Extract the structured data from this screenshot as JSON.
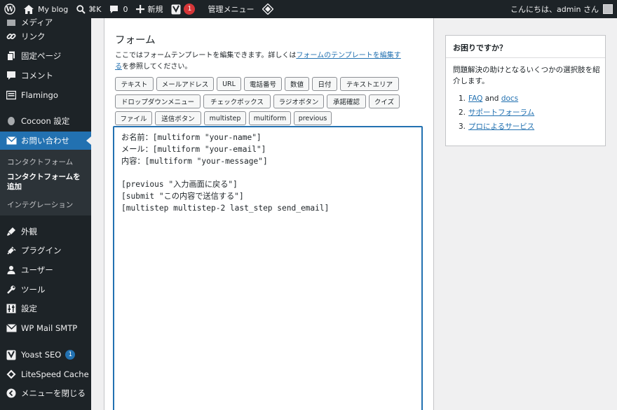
{
  "adminbar": {
    "site_name": "My blog",
    "search_shortcut": "⌘K",
    "comments_count": "0",
    "new_label": "新規",
    "yoast_count": "1",
    "manage_menu": "管理メニュー",
    "greeting": "こんにちは、admin さん"
  },
  "sidebar": {
    "items": [
      {
        "label": "メディア"
      },
      {
        "label": "リンク"
      },
      {
        "label": "固定ページ"
      },
      {
        "label": "コメント"
      },
      {
        "label": "Flamingo"
      },
      {
        "label": "Cocoon 設定"
      },
      {
        "label": "お問い合わせ"
      },
      {
        "label": "外観"
      },
      {
        "label": "プラグイン"
      },
      {
        "label": "ユーザー"
      },
      {
        "label": "ツール"
      },
      {
        "label": "設定"
      },
      {
        "label": "WP Mail SMTP"
      },
      {
        "label": "Yoast SEO",
        "badge": "1"
      },
      {
        "label": "LiteSpeed Cache"
      },
      {
        "label": "メニューを閉じる"
      }
    ],
    "submenu": {
      "contact_forms": "コンタクトフォーム",
      "add_new_line1": "コンタクトフォームを",
      "add_new_line2": "追加",
      "integration": "インテグレーション"
    }
  },
  "form_panel": {
    "title": "フォーム",
    "desc_before": "ここではフォームテンプレートを編集できます。詳しくは",
    "desc_link_line1": "フォームのテンプレートを編集す",
    "desc_link_line2": "る",
    "desc_after": "を参照してください。",
    "tags": [
      "テキスト",
      "メールアドレス",
      "URL",
      "電話番号",
      "数値",
      "日付",
      "テキストエリア",
      "ドロップダウンメニュー",
      "チェックボックス",
      "ラジオボタン",
      "承諾確認",
      "クイズ",
      "ファイル",
      "送信ボタン",
      "multistep",
      "multiform",
      "previous"
    ],
    "template_lines": [
      "お名前：[multiform \"your-name\"]",
      "メール：[multiform \"your-email\"]",
      "内容：[multiform \"your-message\"]",
      "",
      "[previous \"入力画面に戻る\"]",
      "[submit \"この内容で送信する\"]",
      "[multistep multistep-2 last_step send_email]"
    ]
  },
  "help": {
    "title": "お困りですか？",
    "desc": "問題解決の助けとなるいくつかの選択肢を紹介します。",
    "items": [
      {
        "num": "1.",
        "link1": "FAQ",
        "and": " and ",
        "link2": "docs"
      },
      {
        "num": "2.",
        "link1": "サポートフォーラム"
      },
      {
        "num": "3.",
        "link1": "プロによるサービス"
      }
    ]
  },
  "colors": {
    "accent": "#2271b1",
    "sidebar_bg": "#1d2327",
    "badge_red": "#d63638"
  }
}
